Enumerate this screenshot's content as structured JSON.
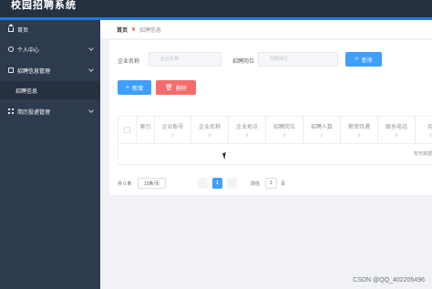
{
  "app": {
    "title": "校园招聘系统"
  },
  "sidebar": {
    "items": [
      {
        "label": "首页",
        "icon": "home-icon"
      },
      {
        "label": "个人中心",
        "icon": "user-icon"
      },
      {
        "label": "招聘信息管理",
        "icon": "briefcase-icon"
      },
      {
        "label": "招聘信息",
        "icon": ""
      },
      {
        "label": "简历投递管理",
        "icon": "grid-icon"
      }
    ]
  },
  "breadcrumb": {
    "home": "首页",
    "separator": "🔗",
    "current": "招聘信息"
  },
  "search": {
    "company_label": "企业名称",
    "company_placeholder": "企业名称",
    "position_label": "招聘岗位",
    "position_placeholder": "招聘岗位",
    "query_button": "查询"
  },
  "actions": {
    "add_button": "新增",
    "delete_button": "删除"
  },
  "table": {
    "columns": [
      "索引",
      "企业账号",
      "企业名称",
      "企业地点",
      "招聘岗位",
      "招聘人数",
      "薪资待遇",
      "联系电话",
      "招"
    ],
    "sort_mark": "⇕",
    "empty_text": "暂无数据"
  },
  "pagination": {
    "total": "共 0 条",
    "page_size": "10条/页",
    "prev": "‹",
    "current_page": "1",
    "next": "›",
    "goto_label": "前往",
    "goto_value": "1",
    "page_suffix": "页"
  },
  "watermark": "CSDN @QQ_402205496",
  "colors": {
    "topbar": "#253141",
    "accent": "#1d79e6",
    "sidebar": "#2e3b4e",
    "primary": "#409eff",
    "danger": "#f56c6c"
  }
}
